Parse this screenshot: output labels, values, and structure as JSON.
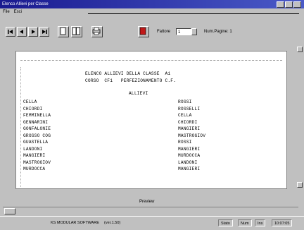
{
  "window": {
    "title": "Elenco Allievi per Classe"
  },
  "menu": {
    "items": [
      "File",
      "Esci"
    ]
  },
  "toolbar": {
    "fattore_label": "Fattore",
    "fattore_value": "1",
    "num_pagine": "Num.Pagine: 1"
  },
  "document": {
    "heading1": "ELENCO ALLIEVI DELLA CLASSE  A1",
    "heading2": "CORSO  CF1   PERFEZIONAMENTO C.F.",
    "section": "ALLIEVI",
    "left_col": [
      "CELLA",
      "CHIORDI",
      "FEMMINELLA",
      "GENNARINI",
      "GONFALONIE",
      "GROSSO COG",
      "GUASTELLA",
      "LANDONI",
      "MANGIERI",
      "MASTROGIOV",
      "MURDOCCA"
    ],
    "right_col": [
      "ROSSI",
      "ROSSELLI",
      "CELLA",
      "CHIORDI",
      "MANGIERI",
      "MASTROGIOV",
      "ROSSI",
      "MANGIERI",
      "MURDOCCA",
      "LANDONI",
      "MANGIERI"
    ]
  },
  "status": {
    "label": "Preview"
  },
  "taskbar": {
    "company": "KS MODULAR SOFTWARE",
    "version": "(ver.1.50)",
    "cells": [
      "Stato",
      "Num",
      "Ins",
      "10:07:05"
    ]
  }
}
